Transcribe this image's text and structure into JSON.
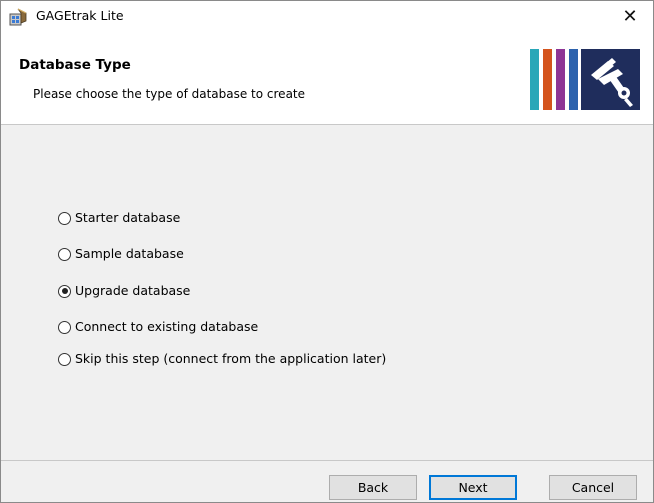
{
  "window": {
    "title": "GAGEtrak Lite",
    "close_glyph": "✕"
  },
  "banner": {
    "title": "Database Type",
    "subtitle": "Please choose the type of database to create",
    "logo_bar_colors": [
      "#29a7b8",
      "#d4541e",
      "#8e3596",
      "#2c62ad"
    ],
    "logo_panel_color": "#1f2d5c"
  },
  "options": [
    {
      "label": "Starter database",
      "checked": false
    },
    {
      "label": "Sample database",
      "checked": false
    },
    {
      "label": "Upgrade database",
      "checked": true
    },
    {
      "label": "Connect to existing database",
      "checked": false
    },
    {
      "label": "Skip this step (connect from the application later)",
      "checked": false
    }
  ],
  "buttons": {
    "back": "Back",
    "next": "Next",
    "cancel": "Cancel"
  },
  "colors": {
    "accent": "#0078d7",
    "panel_background": "#f0f0f0"
  }
}
